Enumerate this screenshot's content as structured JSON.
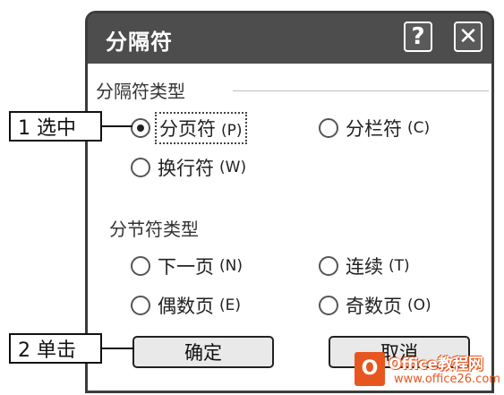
{
  "dialog": {
    "title": "分隔符",
    "help_glyph": "?",
    "close_glyph": "✕"
  },
  "break_type": {
    "label": "分隔符类型",
    "options": [
      {
        "label": "分页符",
        "key": "(P)",
        "selected": true
      },
      {
        "label": "分栏符",
        "key": "(C)",
        "selected": false
      },
      {
        "label": "换行符",
        "key": "(W)",
        "selected": false
      }
    ]
  },
  "section_break_type": {
    "label": "分节符类型",
    "options": [
      {
        "label": "下一页",
        "key": "(N)",
        "selected": false
      },
      {
        "label": "连续",
        "key": "(T)",
        "selected": false
      },
      {
        "label": "偶数页",
        "key": "(E)",
        "selected": false
      },
      {
        "label": "奇数页",
        "key": "(O)",
        "selected": false
      }
    ]
  },
  "buttons": {
    "ok": "确定",
    "cancel": "取消"
  },
  "annotations": {
    "step1": "1 选中",
    "step2": "2 单击"
  },
  "watermark": {
    "logo_letter": "O",
    "line1": "Office教程网",
    "line2": "www.office26.com"
  }
}
